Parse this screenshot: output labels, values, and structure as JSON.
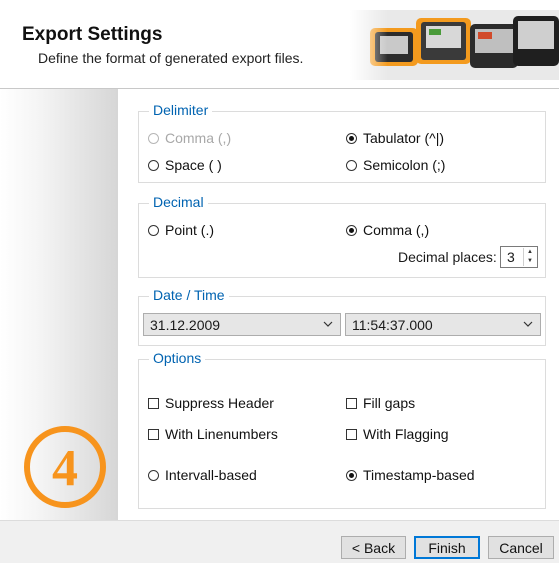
{
  "header": {
    "title": "Export Settings",
    "subtitle": "Define the format of generated export files."
  },
  "step_number": "4",
  "delimiter": {
    "legend": "Delimiter",
    "options": {
      "comma": {
        "label": "Comma (,)",
        "selected": false,
        "disabled": true
      },
      "tabulator": {
        "label": "Tabulator (^|)",
        "selected": true
      },
      "space": {
        "label": "Space ( )",
        "selected": false
      },
      "semicolon": {
        "label": "Semicolon (;)",
        "selected": false
      }
    }
  },
  "decimal": {
    "legend": "Decimal",
    "options": {
      "point": {
        "label": "Point (.)",
        "selected": false
      },
      "comma": {
        "label": "Comma (,)",
        "selected": true
      }
    },
    "places_label": "Decimal places:",
    "places_value": "3"
  },
  "datetime": {
    "legend": "Date / Time",
    "date_value": "31.12.2009",
    "time_value": "11:54:37.000"
  },
  "options": {
    "legend": "Options",
    "suppress_header": {
      "label": "Suppress Header",
      "checked": false
    },
    "fill_gaps": {
      "label": "Fill gaps",
      "checked": false
    },
    "with_linenumbers": {
      "label": "With Linenumbers",
      "checked": false
    },
    "with_flagging": {
      "label": "With Flagging",
      "checked": false
    },
    "intervall_based": {
      "label": "Intervall-based",
      "selected": false
    },
    "timestamp_based": {
      "label": "Timestamp-based",
      "selected": true
    }
  },
  "buttons": {
    "back": "< Back",
    "finish": "Finish",
    "cancel": "Cancel"
  },
  "colors": {
    "accent": "#0063b1",
    "step_orange": "#f7941d",
    "primary_button_border": "#0078d7"
  }
}
